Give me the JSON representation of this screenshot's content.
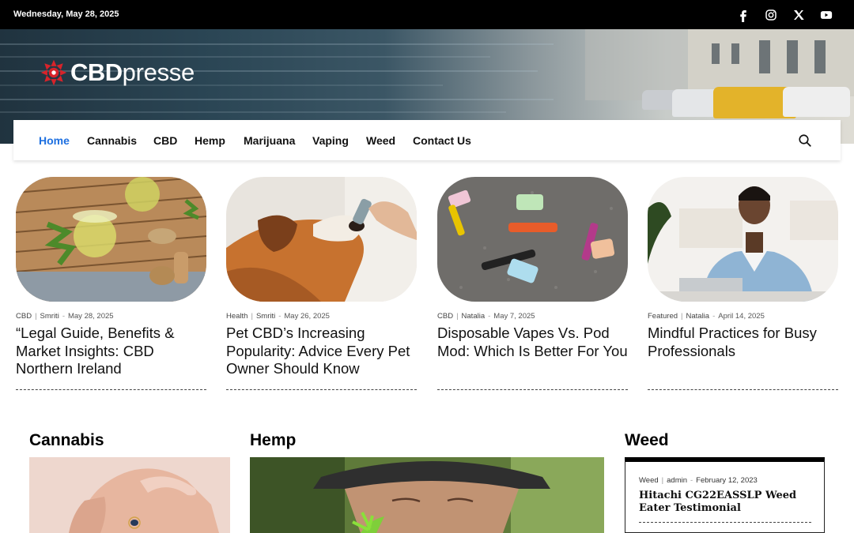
{
  "topbar": {
    "date": "Wednesday, May 28, 2025",
    "social": [
      "facebook-icon",
      "instagram-icon",
      "x-icon",
      "youtube-icon"
    ]
  },
  "brand": {
    "name_bold": "CBD",
    "name_light": "presse",
    "accent": "#d8232a"
  },
  "nav": {
    "items": [
      "Home",
      "Cannabis",
      "CBD",
      "Hemp",
      "Marijuana",
      "Vaping",
      "Weed",
      "Contact Us"
    ],
    "active_color": "#1d6fe0",
    "search_icon": "search-icon"
  },
  "featured": [
    {
      "category": "CBD",
      "author": "Smriti",
      "date": "May 28, 2025",
      "title": "“Legal Guide, Benefits & Market Insights: CBD Northern Ireland"
    },
    {
      "category": "Health",
      "author": "Smriti",
      "date": "May 26, 2025",
      "title": "Pet CBD’s Increasing Popularity: Advice Every Pet Owner Should Know"
    },
    {
      "category": "CBD",
      "author": "Natalia",
      "date": "May 7, 2025",
      "title": "Disposable Vapes Vs. Pod Mod: Which Is Better For You"
    },
    {
      "category": "Featured",
      "author": "Natalia",
      "date": "April 14, 2025",
      "title": "Mindful Practices for Busy Professionals"
    }
  ],
  "sections": {
    "cannabis": {
      "title": "Cannabis"
    },
    "hemp": {
      "title": "Hemp"
    },
    "weed": {
      "title": "Weed",
      "post": {
        "category": "Weed",
        "author": "admin",
        "date": "February 12, 2023",
        "title": "Hitachi CG22EASSLP Weed Eater Testimonial"
      }
    }
  }
}
